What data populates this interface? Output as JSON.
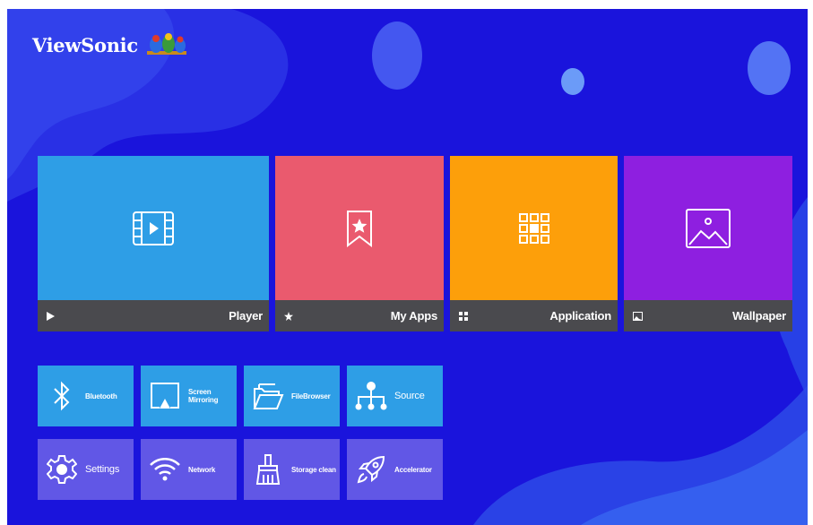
{
  "brand": {
    "name": "ViewSonic"
  },
  "colors": {
    "background": "#1a14dc",
    "player": "#2e9ee6",
    "my_apps": "#ea5a6e",
    "application": "#fd9f0a",
    "wallpaper": "#8e1fe0",
    "tile_bar": "#4a4a4e"
  },
  "tiles": [
    {
      "label": "Player",
      "icon": "film-play-icon",
      "bar_icon": "play-icon"
    },
    {
      "label": "My Apps",
      "icon": "bookmark-star-icon",
      "bar_icon": "star-icon"
    },
    {
      "label": "Application",
      "icon": "app-grid-icon",
      "bar_icon": "small-grid-icon"
    },
    {
      "label": "Wallpaper",
      "icon": "picture-icon",
      "bar_icon": "small-picture-icon"
    }
  ],
  "shortcuts": [
    {
      "label": "Bluetooth",
      "icon": "bluetooth-icon"
    },
    {
      "label": "Screen Mirroring",
      "icon": "screen-mirroring-icon"
    },
    {
      "label": "FileBrowser",
      "icon": "folder-icon"
    },
    {
      "label": "Source",
      "icon": "source-icon"
    },
    {
      "label": "Settings",
      "icon": "gear-icon"
    },
    {
      "label": "Network",
      "icon": "wifi-icon"
    },
    {
      "label": "Storage clean",
      "icon": "broom-icon"
    },
    {
      "label": "Accelerator",
      "icon": "rocket-icon"
    }
  ]
}
